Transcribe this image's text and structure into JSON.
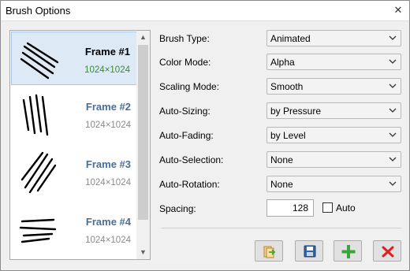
{
  "window": {
    "title": "Brush Options",
    "close_glyph": "✕"
  },
  "frames": [
    {
      "name": "Frame #1",
      "size": "1024×1024",
      "selected": true
    },
    {
      "name": "Frame #2",
      "size": "1024×1024",
      "selected": false
    },
    {
      "name": "Frame #3",
      "size": "1024×1024",
      "selected": false
    },
    {
      "name": "Frame #4",
      "size": "1024×1024",
      "selected": false
    }
  ],
  "scrollbar": {
    "up_glyph": "▲",
    "down_glyph": "▼"
  },
  "fields": {
    "brush_type": {
      "label": "Brush Type:",
      "value": "Animated"
    },
    "color_mode": {
      "label": "Color Mode:",
      "value": "Alpha"
    },
    "scaling_mode": {
      "label": "Scaling Mode:",
      "value": "Smooth"
    },
    "auto_sizing": {
      "label": "Auto-Sizing:",
      "value": "by Pressure"
    },
    "auto_fading": {
      "label": "Auto-Fading:",
      "value": "by Level"
    },
    "auto_selection": {
      "label": "Auto-Selection:",
      "value": "None"
    },
    "auto_rotation": {
      "label": "Auto-Rotation:",
      "value": "None"
    },
    "spacing": {
      "label": "Spacing:",
      "value": "128",
      "auto_label": "Auto",
      "auto_checked": false
    }
  },
  "toolbar": {
    "buttons": [
      {
        "icon": "import-icon"
      },
      {
        "icon": "save-icon"
      },
      {
        "icon": "add-icon"
      },
      {
        "icon": "delete-icon"
      }
    ],
    "colors": {
      "add": "#3aa53a",
      "delete": "#e02020",
      "save": "#3465a4",
      "import": "#e8b44a"
    }
  }
}
